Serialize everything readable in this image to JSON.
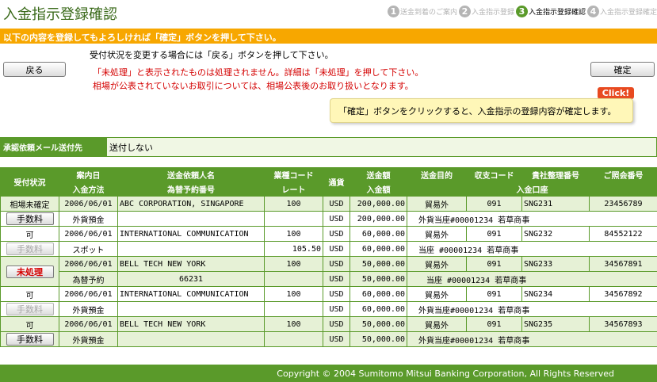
{
  "page_title": "入金指示登録確認",
  "steps": [
    {
      "num": "1",
      "label": "送金到着のご案内",
      "active": false
    },
    {
      "num": "2",
      "label": "入金指示登録",
      "active": false
    },
    {
      "num": "3",
      "label": "入金指示登録確認",
      "active": true
    },
    {
      "num": "4",
      "label": "入金指示登録確定",
      "active": false
    }
  ],
  "banner": "以下の内容を登録してもよろしければ「確定」ボタンを押して下さい。",
  "back_button": "戻る",
  "confirm_button": "確定",
  "info_line": "受付状況を変更する場合には「戻る」ボタンを押して下さい。",
  "warning_1": "「未処理」と表示されたものは処理されません。詳細は「未処理」を押して下さい。",
  "warning_2": "相場が公表されていないお取引については、相場公表後のお取り扱いとなります。",
  "click_badge": "Click!",
  "tooltip": "「確定」ボタンをクリックすると、入金指示の登録内容が確定します。",
  "mail": {
    "label": "承認依頼メール送付先",
    "value": "送付しない"
  },
  "table": {
    "header_status": "受付状況",
    "header_top": [
      "案内日",
      "送金依頼人名",
      "業種コード",
      "通貨",
      "送金額",
      "送金目的",
      "収支コード",
      "貴社整理番号",
      "ご照会番号"
    ],
    "header_bottom": [
      "入金方法",
      "為替予約番号",
      "レート",
      "入金額",
      "入金口座"
    ],
    "rows": [
      {
        "status": "相場未確定",
        "button": "手数料",
        "button_state": "normal",
        "date": "2006/06/01",
        "remitter": "ABC CORPORATION, SINGAPORE",
        "industry": "100",
        "currency": "USD",
        "amount": "200,000.00",
        "purpose": "貿易外",
        "code": "091",
        "ref": "SNG231",
        "inquiry": "23456789",
        "method": "外貨預金",
        "contract": "",
        "rate": "",
        "currency2": "USD",
        "deposit": "200,000.00",
        "account": "外貨当座#00001234 若草商事"
      },
      {
        "status": "可",
        "button": "手数料",
        "button_state": "disabled",
        "date": "2006/06/01",
        "remitter": "INTERNATIONAL COMMUNICATION",
        "industry": "100",
        "currency": "USD",
        "amount": "60,000.00",
        "purpose": "貿易外",
        "code": "091",
        "ref": "SNG232",
        "inquiry": "84552122",
        "method": "スポット",
        "contract": "",
        "rate": "105.50",
        "currency2": "USD",
        "deposit": "60,000.00",
        "account": "当座 #00001234 若草商事"
      },
      {
        "status": "",
        "button": "未処理",
        "button_state": "red",
        "date": "2006/06/01",
        "remitter": "BELL TECH NEW YORK",
        "industry": "100",
        "currency": "USD",
        "amount": "50,000.00",
        "purpose": "貿易外",
        "code": "091",
        "ref": "SNG233",
        "inquiry": "34567891",
        "method": "為替予約",
        "contract": "66231",
        "rate": "",
        "currency2": "USD",
        "deposit": "50,000.00",
        "account": "当座 #00001234 若草商事"
      },
      {
        "status": "可",
        "button": "手数料",
        "button_state": "disabled",
        "date": "2006/06/01",
        "remitter": "INTERNATIONAL COMMUNICATION",
        "industry": "100",
        "currency": "USD",
        "amount": "60,000.00",
        "purpose": "貿易外",
        "code": "091",
        "ref": "SNG234",
        "inquiry": "34567892",
        "method": "外貨預金",
        "contract": "",
        "rate": "",
        "currency2": "USD",
        "deposit": "60,000.00",
        "account": "外貨当座#00001234 若草商事"
      },
      {
        "status": "可",
        "button": "手数料",
        "button_state": "normal",
        "date": "2006/06/01",
        "remitter": "BELL TECH NEW YORK",
        "industry": "100",
        "currency": "USD",
        "amount": "50,000.00",
        "purpose": "貿易外",
        "code": "091",
        "ref": "SNG235",
        "inquiry": "34567893",
        "method": "外貨預金",
        "contract": "",
        "rate": "",
        "currency2": "USD",
        "deposit": "50,000.00",
        "account": "外貨当座#00001234 若草商事"
      }
    ]
  },
  "footer": "Copyright © 2004 Sumitomo Mitsui Banking Corporation, All Rights Reserved",
  "colors": {
    "brand_green": "#5a9a2a",
    "banner_orange": "#f7a700",
    "warning_red": "#d40000",
    "row_tint": "#e6f1d6"
  }
}
